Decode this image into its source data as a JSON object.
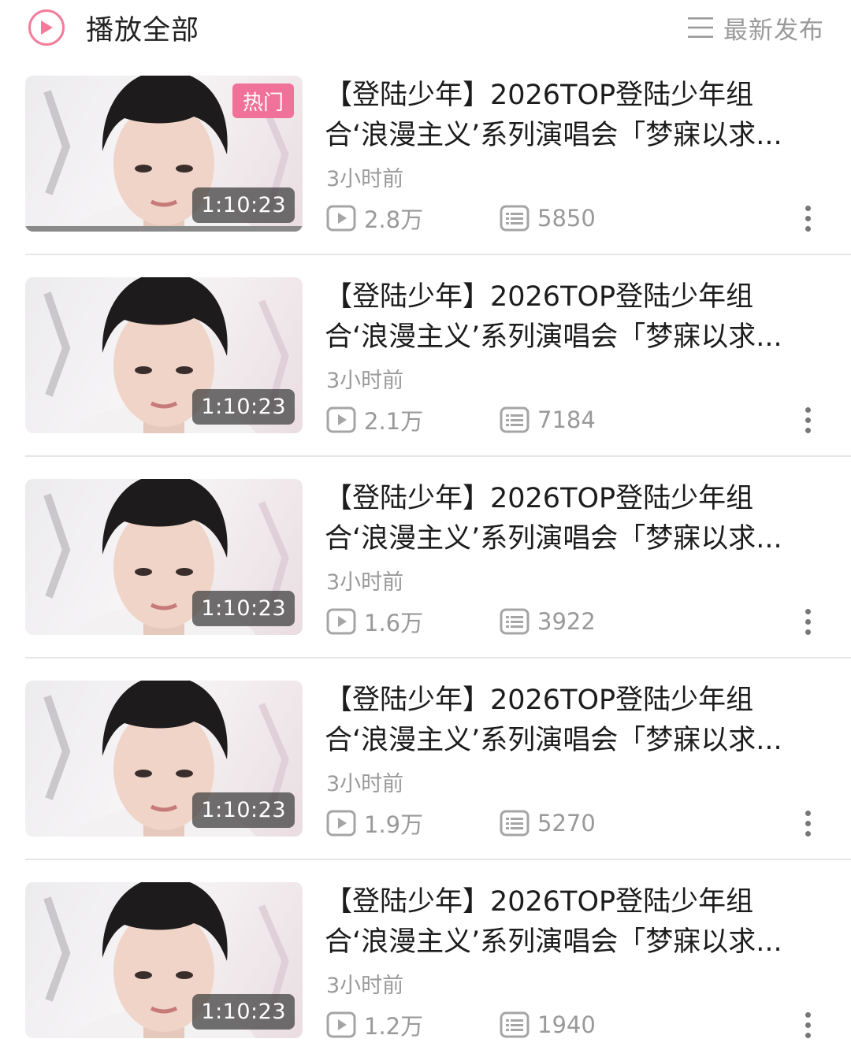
{
  "header": {
    "play_all_label": "播放全部",
    "sort_label": "最新发布",
    "accent_color": "#f37c9b"
  },
  "videos": [
    {
      "title_line1": "【登陆少年】2026TOP登陆少年组",
      "title_line2": "合‘浪漫主义’系列演唱会「梦寐以求...",
      "time_ago": "3小时前",
      "duration": "1:10:23",
      "views": "2.8万",
      "comments": "5850",
      "badge": "热门"
    },
    {
      "title_line1": "【登陆少年】2026TOP登陆少年组",
      "title_line2": "合‘浪漫主义’系列演唱会「梦寐以求...",
      "time_ago": "3小时前",
      "duration": "1:10:23",
      "views": "2.1万",
      "comments": "7184"
    },
    {
      "title_line1": "【登陆少年】2026TOP登陆少年组",
      "title_line2": "合‘浪漫主义’系列演唱会「梦寐以求...",
      "time_ago": "3小时前",
      "duration": "1:10:23",
      "views": "1.6万",
      "comments": "3922"
    },
    {
      "title_line1": "【登陆少年】2026TOP登陆少年组",
      "title_line2": "合‘浪漫主义’系列演唱会「梦寐以求...",
      "time_ago": "3小时前",
      "duration": "1:10:23",
      "views": "1.9万",
      "comments": "5270"
    },
    {
      "title_line1": "【登陆少年】2026TOP登陆少年组",
      "title_line2": "合‘浪漫主义’系列演唱会「梦寐以求...",
      "time_ago": "3小时前",
      "duration": "1:10:23",
      "views": "1.2万",
      "comments": "1940"
    }
  ],
  "icons": {
    "play_all": "play-circle-icon",
    "sort": "list-lines-icon",
    "views": "play-count-icon",
    "comments": "danmaku-icon",
    "more": "more-vertical-icon"
  }
}
